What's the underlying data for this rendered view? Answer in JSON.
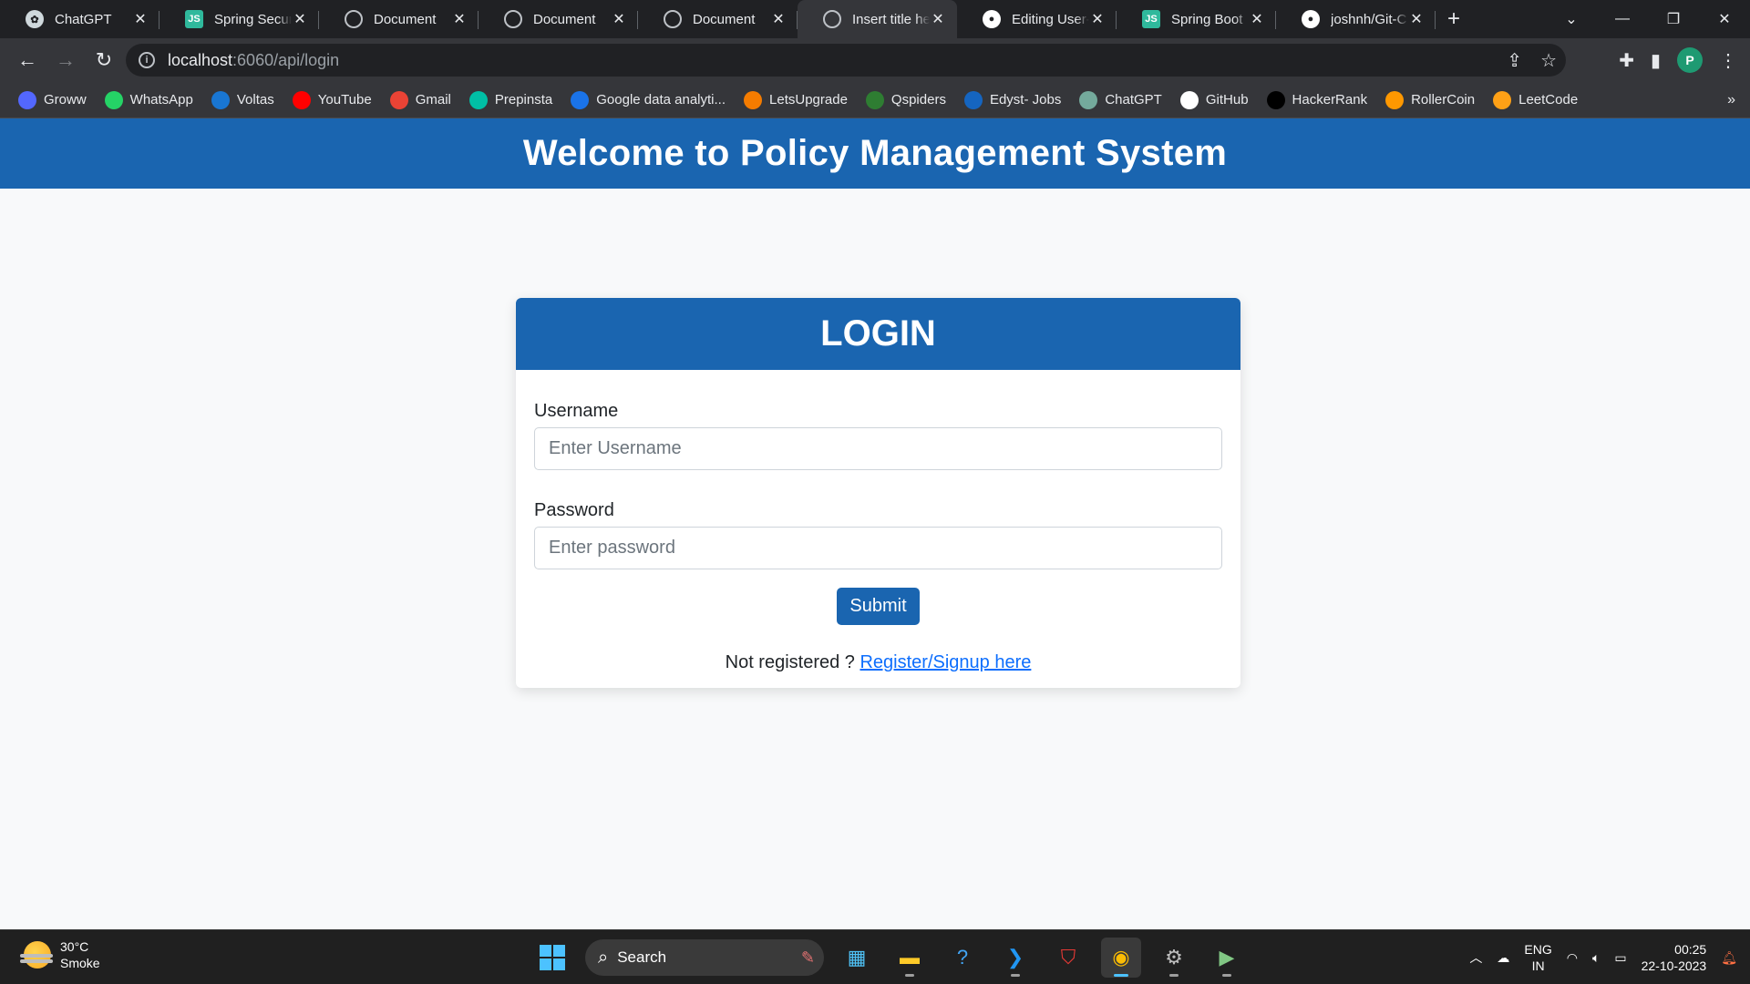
{
  "browser": {
    "tabs": [
      {
        "label": "ChatGPT",
        "icon": "chatgpt-icon",
        "active": false
      },
      {
        "label": "Spring Security",
        "icon": "spring-icon",
        "active": false
      },
      {
        "label": "Document",
        "icon": "globe-icon",
        "active": false
      },
      {
        "label": "Document",
        "icon": "globe-icon",
        "active": false
      },
      {
        "label": "Document",
        "icon": "globe-icon",
        "active": false
      },
      {
        "label": "Insert title here",
        "icon": "globe-icon",
        "active": true
      },
      {
        "label": "Editing User-",
        "icon": "github-icon",
        "active": false
      },
      {
        "label": "Spring Boot",
        "icon": "spring-icon",
        "active": false
      },
      {
        "label": "joshnh/Git-C",
        "icon": "github-icon",
        "active": false
      }
    ],
    "url_host": "localhost",
    "url_path": ":6060/api/login",
    "profile_initial": "P",
    "bookmarks": [
      {
        "label": "Groww",
        "color": "#5367ff"
      },
      {
        "label": "WhatsApp",
        "color": "#25d366"
      },
      {
        "label": "Voltas",
        "color": "#1976d2"
      },
      {
        "label": "YouTube",
        "color": "#ff0000"
      },
      {
        "label": "Gmail",
        "color": "#ea4335"
      },
      {
        "label": "Prepinsta",
        "color": "#00bfa5"
      },
      {
        "label": "Google data analyti...",
        "color": "#1a73e8"
      },
      {
        "label": "LetsUpgrade",
        "color": "#f57c00"
      },
      {
        "label": "Qspiders",
        "color": "#2e7d32"
      },
      {
        "label": "Edyst- Jobs",
        "color": "#1565c0"
      },
      {
        "label": "ChatGPT",
        "color": "#74aa9c"
      },
      {
        "label": "GitHub",
        "color": "#ffffff"
      },
      {
        "label": "HackerRank",
        "color": "#000000"
      },
      {
        "label": "RollerCoin",
        "color": "#ff9800"
      },
      {
        "label": "LeetCode",
        "color": "#ffa116"
      }
    ]
  },
  "site": {
    "header_title": "Welcome to Policy Management System",
    "brand_color": "#1a65b0"
  },
  "login": {
    "title": "LOGIN",
    "username_label": "Username",
    "username_placeholder": "Enter Username",
    "password_label": "Password",
    "password_placeholder": "Enter password",
    "submit_label": "Submit",
    "register_prompt": "Not registered ? ",
    "register_link": "Register/Signup here"
  },
  "taskbar": {
    "weather_temp": "30°C",
    "weather_desc": "Smoke",
    "search_label": "Search",
    "lang_primary": "ENG",
    "lang_secondary": "IN",
    "time": "00:25",
    "date": "22-10-2023"
  }
}
